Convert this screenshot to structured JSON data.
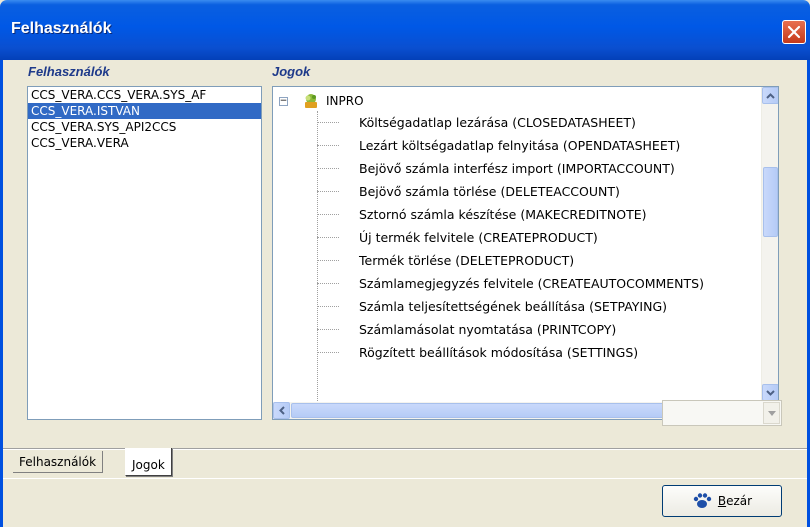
{
  "window": {
    "title": "Felhasználók"
  },
  "users_panel": {
    "label": "Felhasználók",
    "items": [
      {
        "text": "CCS_VERA.CCS_VERA.SYS_AF",
        "selected": false
      },
      {
        "text": "CCS_VERA.ISTVAN",
        "selected": true
      },
      {
        "text": "CCS_VERA.SYS_API2CCS",
        "selected": false
      },
      {
        "text": "CCS_VERA.VERA",
        "selected": false
      }
    ]
  },
  "rights_panel": {
    "label": "Jogok",
    "root": {
      "label": "INPRO",
      "icon": "inpro-app-icon",
      "expander": "−"
    },
    "items": [
      "Költségadatlap lezárása (CLOSEDATASHEET)",
      "Lezárt költségadatlap felnyitása (OPENDATASHEET)",
      "Bejövő számla interfész import (IMPORTACCOUNT)",
      "Bejövő számla törlése (DELETEACCOUNT)",
      "Sztornó számla készítése (MAKECREDITNOTE)",
      "Új termék felvitele (CREATEPRODUCT)",
      "Termék törlése (DELETEPRODUCT)",
      "Számlamegjegyzés felvitele (CREATEAUTOCOMMENTS)",
      "Számla teljesítettségének beállítása (SETPAYING)",
      "Számlamásolat nyomtatása (PRINTCOPY)",
      "Rögzített beállítások módosítása (SETTINGS)"
    ]
  },
  "combo": {
    "value": ""
  },
  "tabs": [
    {
      "label": "Felhasználók",
      "active": false
    },
    {
      "label": "Jogok",
      "active": true
    }
  ],
  "close_button": {
    "label_prefix": "",
    "label_underlined": "B",
    "label_rest": "ezár",
    "icon": "paw-icon"
  },
  "colors": {
    "titlebar": "#0058E6",
    "selection": "#316AC5",
    "group_label": "#1E3A8A"
  }
}
